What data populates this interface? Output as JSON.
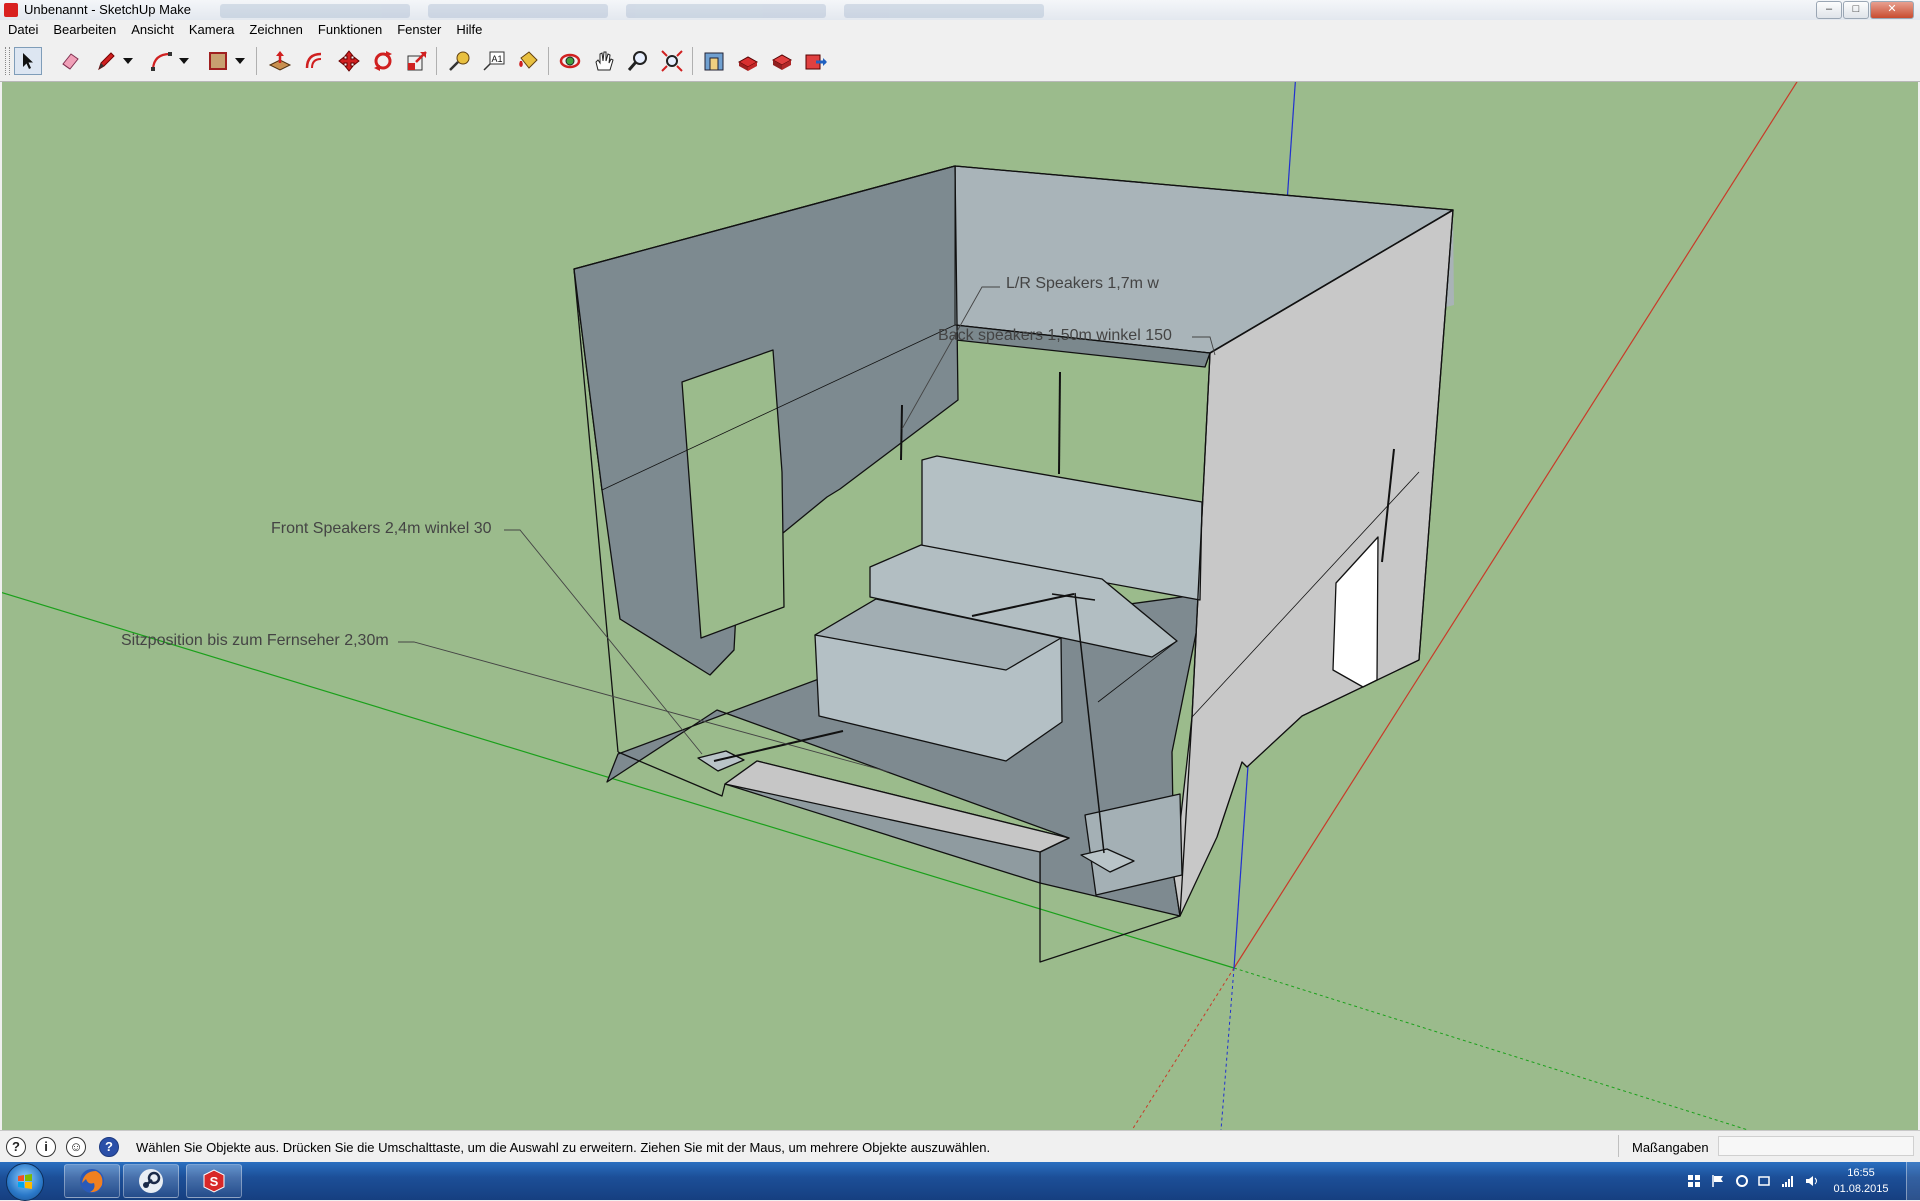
{
  "window": {
    "title": "Unbenannt - SketchUp Make",
    "min": "–",
    "max": "□",
    "close": "✕"
  },
  "menu": [
    "Datei",
    "Bearbeiten",
    "Ansicht",
    "Kamera",
    "Zeichnen",
    "Funktionen",
    "Fenster",
    "Hilfe"
  ],
  "toolbar": {
    "tools": [
      "select-tool",
      "eraser-tool",
      "pencil-tool",
      "line-dropdown",
      "arc-tool",
      "arc-dropdown",
      "rectangle-tool",
      "rectangle-dropdown",
      "push-pull-tool",
      "offset-tool",
      "move-tool",
      "rotate-tool",
      "scale-tool",
      "tape-measure-tool",
      "text-tool",
      "paint-bucket-tool",
      "orbit-tool",
      "pan-tool",
      "zoom-tool",
      "zoom-extents-tool",
      "warehouse-tool",
      "components-tool",
      "extension-warehouse-tool",
      "export-tool"
    ],
    "text_tool_glyph": "A1"
  },
  "model": {
    "labels": {
      "lr": "L/R Speakers 1,7m w",
      "back": "Back speakers 1,50m winkel 150",
      "front": "Front Speakers 2,4m winkel 30",
      "seat": "Sitzposition bis zum Fernseher 2,30m"
    },
    "colors": {
      "ground": "#9bbb8c",
      "axis_red": "#c83a28",
      "axis_green": "#1aa01a",
      "axis_blue": "#2030d0"
    }
  },
  "status": {
    "icons": [
      "geo-location-icon",
      "credits-icon",
      "user-icon",
      "help-icon"
    ],
    "message": "Wählen Sie Objekte aus. Drücken Sie die Umschalttaste, um die Auswahl zu erweitern. Ziehen Sie mit der Maus, um mehrere Objekte auszuwählen.",
    "measurements_label": "Maßangaben",
    "measurements_value": ""
  },
  "taskbar": {
    "apps": [
      "firefox-icon",
      "steam-icon",
      "sketchup-icon"
    ],
    "time": "16:55",
    "date": "01.08.2015"
  }
}
